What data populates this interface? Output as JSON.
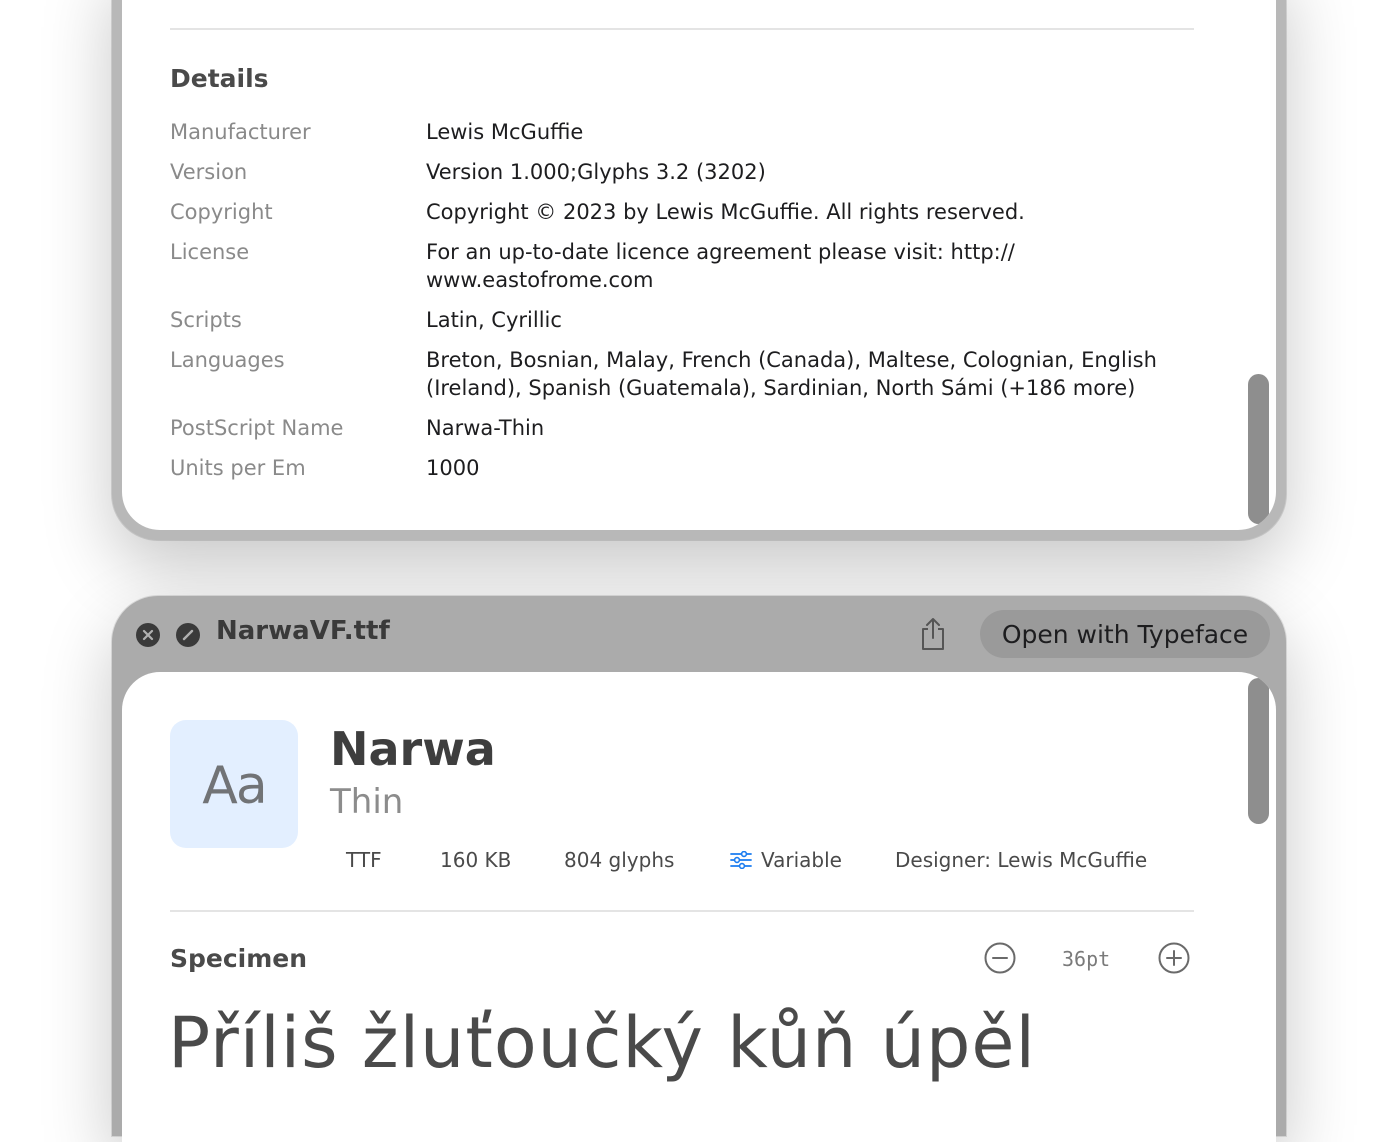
{
  "details": {
    "title": "Details",
    "rows": [
      {
        "label": "Manufacturer",
        "value": "Lewis McGuffie"
      },
      {
        "label": "Version",
        "value": "Version 1.000;Glyphs 3.2 (3202)"
      },
      {
        "label": "Copyright",
        "value": "Copyright © 2023 by Lewis McGuffie. All rights reserved."
      },
      {
        "label": "License",
        "value": "For an up-to-date licence agreement please visit: http://",
        "value2": "www.eastofrome.com"
      },
      {
        "label": "Scripts",
        "value": "Latin, Cyrillic"
      },
      {
        "label": "Languages",
        "value": "Breton, Bosnian, Malay, French (Canada), Maltese, Colognian, English",
        "value2": "(Ireland), Spanish (Guatemala), Sardinian, North Sámi (+186 more)"
      },
      {
        "label": "PostScript Name",
        "value": "Narwa-Thin"
      },
      {
        "label": "Units per Em",
        "value": "1000"
      }
    ]
  },
  "window": {
    "filename": "NarwaVF.ttf",
    "open_button": "Open with Typeface",
    "share_icon": "share-icon",
    "close_icon": "close-icon",
    "disable_icon": "disable-icon"
  },
  "font": {
    "preview": "Aa",
    "name": "Narwa",
    "style": "Thin",
    "format": "TTF",
    "size": "160 KB",
    "glyphs": "804 glyphs",
    "variable": "Variable",
    "designer": "Designer: Lewis McGuffie"
  },
  "specimen": {
    "title": "Specimen",
    "point_size": "36pt",
    "text": "Příliš žluťoučký kůň úpěl"
  },
  "colors": {
    "accent": "#1a7cf0",
    "thumb_bg": "#e3efff"
  }
}
